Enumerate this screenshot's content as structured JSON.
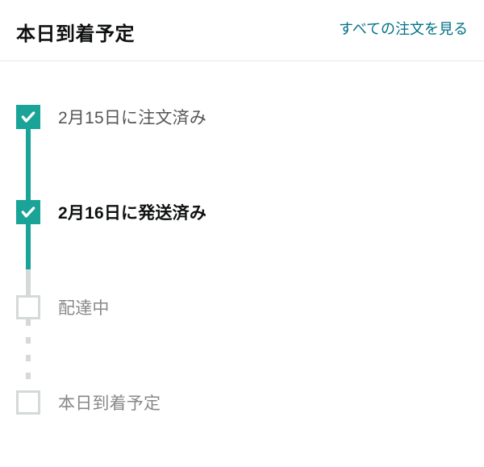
{
  "header": {
    "title": "本日到着予定",
    "view_all": "すべての注文を見る"
  },
  "timeline": {
    "steps": [
      {
        "label": "2月15日に注文済み",
        "status": "done",
        "bold": false
      },
      {
        "label": "2月16日に発送済み",
        "status": "done",
        "bold": true
      },
      {
        "label": "配達中",
        "status": "pending",
        "bold": false
      },
      {
        "label": "本日到着予定",
        "status": "pending",
        "bold": false
      }
    ]
  },
  "colors": {
    "accent": "#1aa397",
    "link": "#007185",
    "pending": "#d5d9d9"
  }
}
